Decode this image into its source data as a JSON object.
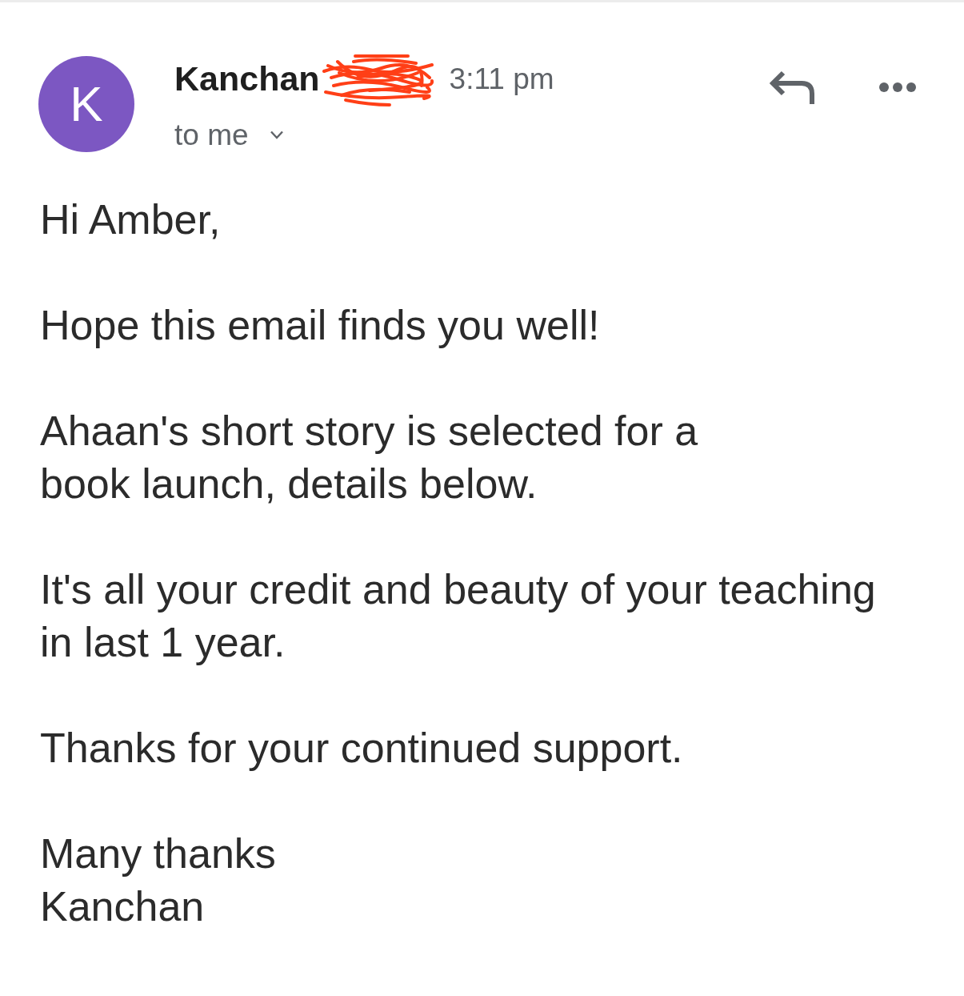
{
  "message_header": {
    "avatar_initial": "K",
    "sender_name": "Kanchan",
    "sender_surname_redacted": true,
    "time": "3:11 pm",
    "recipient": "to me",
    "recipient_details_expanded": false
  },
  "body": {
    "paragraphs": [
      "Hi Amber,",
      "Hope this email finds you well!",
      "Ahaan's short story is selected for a\nbook launch, details below.",
      "It's all your credit and beauty of your teaching\nin last 1 year.",
      "Thanks for your continued support.",
      "Many thanks\nKanchan"
    ]
  }
}
